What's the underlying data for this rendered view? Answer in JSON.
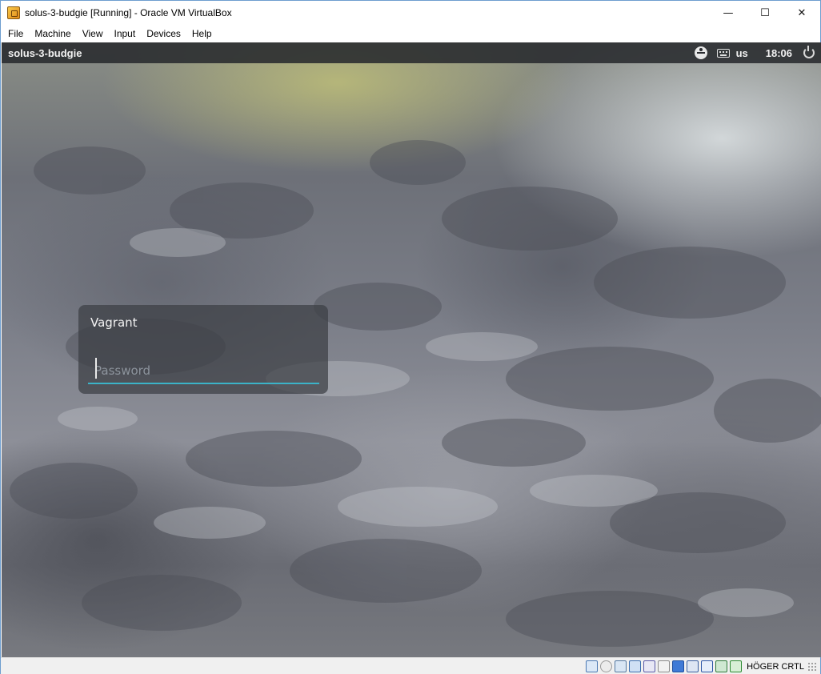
{
  "window": {
    "title": "solus-3-budgie [Running] - Oracle VM VirtualBox",
    "controls": {
      "minimize": "—",
      "maximize": "☐",
      "close": "✕"
    }
  },
  "menu": {
    "items": [
      "File",
      "Machine",
      "View",
      "Input",
      "Devices",
      "Help"
    ]
  },
  "guest": {
    "panel": {
      "hostname": "solus-3-budgie",
      "keyboard_layout": "us",
      "clock": "18:06"
    },
    "login": {
      "user_name": "Vagrant",
      "password_value": "",
      "password_placeholder": "Password",
      "accent_color": "#3bb3c8"
    }
  },
  "statusbar": {
    "icons": [
      "hard-disk-icon",
      "optical-drive-icon",
      "audio-icon",
      "network-icon",
      "usb-icon",
      "shared-folders-icon",
      "display-icon",
      "recording-icon",
      "virtualization-icon",
      "mouse-integration-icon",
      "host-key-icon"
    ],
    "host_key": "HÖGER CRTL"
  }
}
